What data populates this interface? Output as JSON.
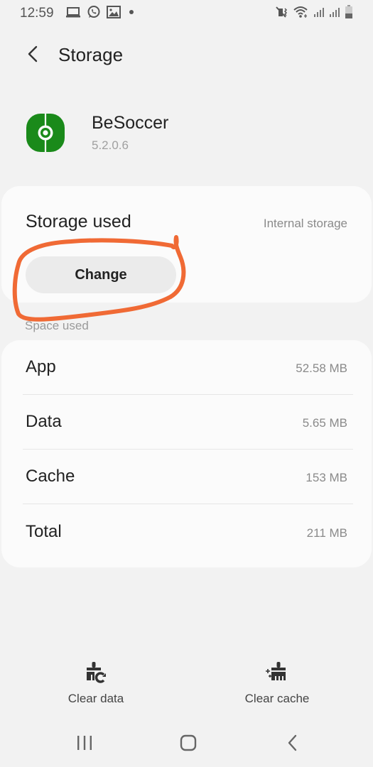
{
  "status_bar": {
    "time": "12:59",
    "left_icons": [
      "laptop-icon",
      "whatsapp-icon",
      "gallery-icon",
      "dot-icon"
    ],
    "right_icons": [
      "mute-vibrate-icon",
      "wifi-icon",
      "signal-1-icon",
      "signal-2-icon",
      "battery-icon"
    ]
  },
  "header": {
    "back_icon": "back-arrow-icon",
    "title": "Storage"
  },
  "app": {
    "name": "BeSoccer",
    "version": "5.2.0.6",
    "icon_color": "#1a8a1a"
  },
  "storage_used": {
    "label": "Storage used",
    "location": "Internal storage",
    "change_button": "Change"
  },
  "annotation": {
    "color": "#f06a35",
    "description": "hand-drawn circle around Change button"
  },
  "space_used": {
    "section_label": "Space used",
    "rows": [
      {
        "label": "App",
        "value": "52.58 MB"
      },
      {
        "label": "Data",
        "value": "5.65 MB"
      },
      {
        "label": "Cache",
        "value": "153 MB"
      },
      {
        "label": "Total",
        "value": "211 MB"
      }
    ]
  },
  "actions": {
    "clear_data": {
      "label": "Clear data",
      "icon": "clear-data-broom-icon"
    },
    "clear_cache": {
      "label": "Clear cache",
      "icon": "clear-cache-broom-icon"
    }
  },
  "nav": {
    "recents": "recents-icon",
    "home": "home-icon",
    "back": "back-icon"
  }
}
